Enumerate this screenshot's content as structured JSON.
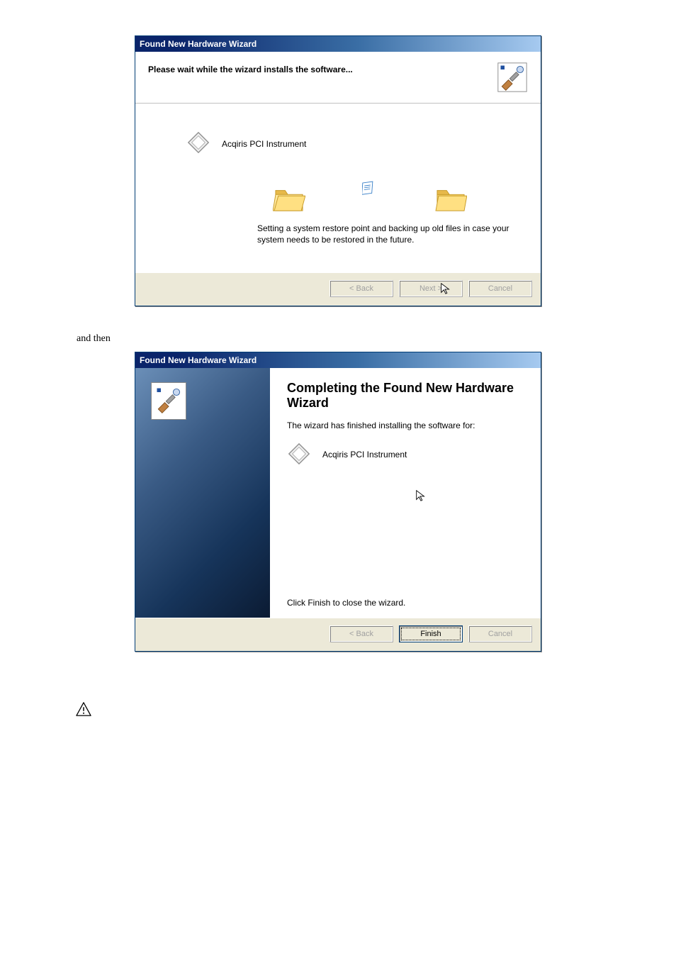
{
  "dialog1": {
    "title": "Found New Hardware Wizard",
    "header": "Please wait while the wizard installs the software...",
    "device_name": "Acqiris PCI Instrument",
    "status": "Setting a system restore point and backing up old files in case your system needs to be restored in the future.",
    "buttons": {
      "back": "< Back",
      "next": "Next >",
      "cancel": "Cancel"
    }
  },
  "between_text": "and then",
  "dialog2": {
    "title": "Found New Hardware Wizard",
    "heading": "Completing the Found New Hardware Wizard",
    "subtext": "The wizard has finished installing the software for:",
    "device_name": "Acqiris PCI Instrument",
    "close_instruction": "Click Finish to close the wizard.",
    "buttons": {
      "back": "< Back",
      "finish": "Finish",
      "cancel": "Cancel"
    }
  }
}
